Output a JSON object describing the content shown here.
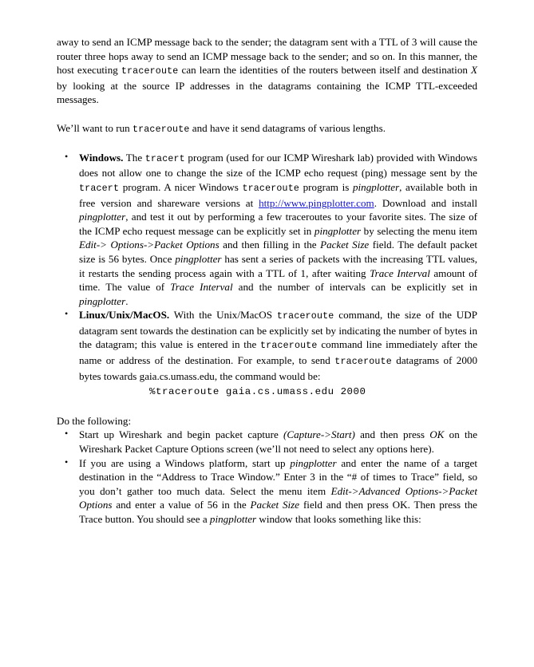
{
  "document": {
    "type": "lab-assignment-page",
    "page_background": "#ffffff",
    "text_color": "#000000",
    "link_color": "#1414d2",
    "paragraph_1": {
      "seg_1": "away to send an ICMP message back to the sender; the datagram sent with a TTL of 3 will cause the router three hops away to send an ICMP message back to the sender; and so on.  In this manner, the host executing ",
      "mono_1": "traceroute",
      "seg_2": " can learn the identities of the routers between itself and destination ",
      "ital_1": "X",
      "seg_3": " by looking at the source IP addresses in the datagrams containing the ICMP TTL-exceeded messages."
    },
    "paragraph_2": {
      "seg_1": "We’ll want to run ",
      "mono_1": "traceroute",
      "seg_2": " and have it send datagrams of various lengths."
    },
    "platform_bullets": [
      {
        "name": "windows-bullet",
        "bold_lead": "Windows.",
        "seg_1": "  The ",
        "mono_1": "tracert",
        "seg_2": " program (used for our ICMP Wireshark lab) provided with Windows does not allow one to change the size of the ICMP echo request (ping) message sent by the ",
        "mono_2": "tracert",
        "seg_3": " program. A nicer Windows ",
        "mono_3": "traceroute",
        "seg_4": " program is ",
        "ital_1": "pingplotter",
        "seg_5": ", available both in free version and shareware versions at ",
        "link_1": "http://www.pingplotter.com",
        "seg_6": ". Download and install ",
        "ital_2": "pingplotter",
        "seg_7": ", and test it out by performing a few traceroutes to your favorite sites.  The size of the ICMP echo request message can be explicitly set in ",
        "ital_3": "pingplotter",
        "seg_8": " by selecting the menu item ",
        "ital_4": "Edit-> Options->Packet Options",
        "seg_9": " and then filling in the ",
        "ital_5": "Packet Size",
        "seg_10": " field.  The default packet size is 56 bytes.  Once ",
        "ital_6": "pingplotter",
        "seg_11": " has sent a series of packets with the increasing TTL values, it restarts the sending process again with a TTL of 1, after waiting ",
        "ital_7": "Trace Interval",
        "seg_12": " amount of time. The value of ",
        "ital_8": "Trace Interval",
        "seg_13": " and the number of intervals can be explicitly set in ",
        "ital_9": "pingplotter",
        "seg_14": "."
      },
      {
        "name": "linux-unix-macos-bullet",
        "bold_lead": "Linux/Unix/MacOS.",
        "seg_1": "  With the Unix/MacOS ",
        "mono_1": "traceroute",
        "seg_2": " command, the size of the UDP datagram sent towards the destination can be explicitly set by indicating the number of bytes in the datagram; this value is entered in the ",
        "mono_2": "traceroute",
        "seg_3": " command line immediately after the name or address of the destination.  For example, to send ",
        "mono_3": "traceroute",
        "seg_4": " datagrams of 2000 bytes towards gaia.cs.umass.edu, the command would be:"
      }
    ],
    "code_line": "%traceroute gaia.cs.umass.edu 2000",
    "do_the_following_label": "Do the following:",
    "step_bullets": [
      {
        "name": "step-wireshark-capture",
        "seg_1": "Start up Wireshark and begin packet capture ",
        "ital_1": "(Capture->Start)",
        "seg_2": " and then press ",
        "ital_2": "OK",
        "seg_3": " on the Wireshark Packet Capture Options screen (we’ll not need to select any options here)."
      },
      {
        "name": "step-pingplotter-setup",
        "seg_1": "If you are using a Windows platform, start up ",
        "ital_1": "pingplotter",
        "seg_2": " and enter the name of a target destination in the “Address to Trace Window.”  Enter 3 in the “# of times to Trace” field, so you don’t gather too much data.  Select the menu item ",
        "ital_2": "Edit->Advanced Options->Packet Options",
        "seg_3": " and enter a value of 56 in the ",
        "ital_3": "Packet Size",
        "seg_4": " field and then press OK.  Then press the Trace button.  You should see a ",
        "ital_4": "pingplotter",
        "seg_5": " window that looks something like this:"
      }
    ]
  }
}
